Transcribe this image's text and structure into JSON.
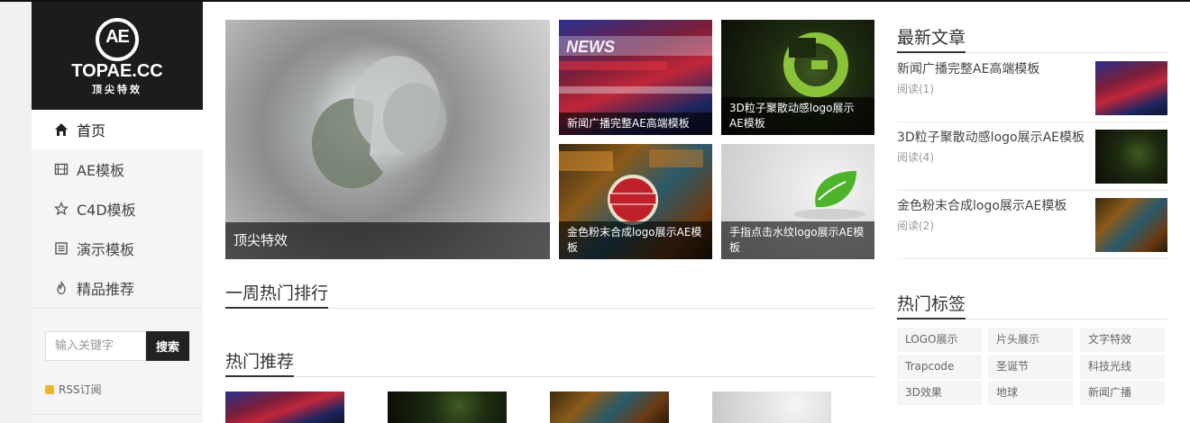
{
  "logo": {
    "mark": "AE",
    "title": "TOPAE.CC",
    "subtitle": "顶尖特效"
  },
  "nav": [
    {
      "label": "首页",
      "icon": "home-icon"
    },
    {
      "label": "AE模板",
      "icon": "film-icon"
    },
    {
      "label": "C4D模板",
      "icon": "star-icon"
    },
    {
      "label": "演示模板",
      "icon": "document-icon"
    },
    {
      "label": "精品推荐",
      "icon": "fire-icon"
    }
  ],
  "search": {
    "placeholder": "输入关键字",
    "button": "搜索"
  },
  "rss": {
    "label": "RSS订阅"
  },
  "featured": {
    "big": {
      "caption": "顶尖特效"
    },
    "small": [
      {
        "caption": "新闻广播完整AE高端模板"
      },
      {
        "caption": "3D粒子聚散动感logo展示AE模板"
      },
      {
        "caption": "金色粉末合成logo展示AE模板"
      },
      {
        "caption": "手指点击水纹logo展示AE模板"
      }
    ]
  },
  "sections": {
    "weekly_hot": "一周热门排行",
    "hot_recommend": "热门推荐",
    "latest_articles": "最新文章",
    "hot_tags": "热门标签"
  },
  "latest_articles": [
    {
      "title": "新闻广播完整AE高端模板",
      "reads": "阅读(1)"
    },
    {
      "title": "3D粒子聚散动感logo展示AE模板",
      "reads": "阅读(4)"
    },
    {
      "title": "金色粉末合成logo展示AE模板",
      "reads": "阅读(2)"
    }
  ],
  "tags": [
    "LOGO展示",
    "片头展示",
    "文字特效",
    "Trapcode",
    "圣诞节",
    "科技光线",
    "3D效果",
    "地球",
    "新闻广播"
  ],
  "colors": {
    "accent_dark": "#1c1c1c",
    "rss": "#e8b830"
  }
}
